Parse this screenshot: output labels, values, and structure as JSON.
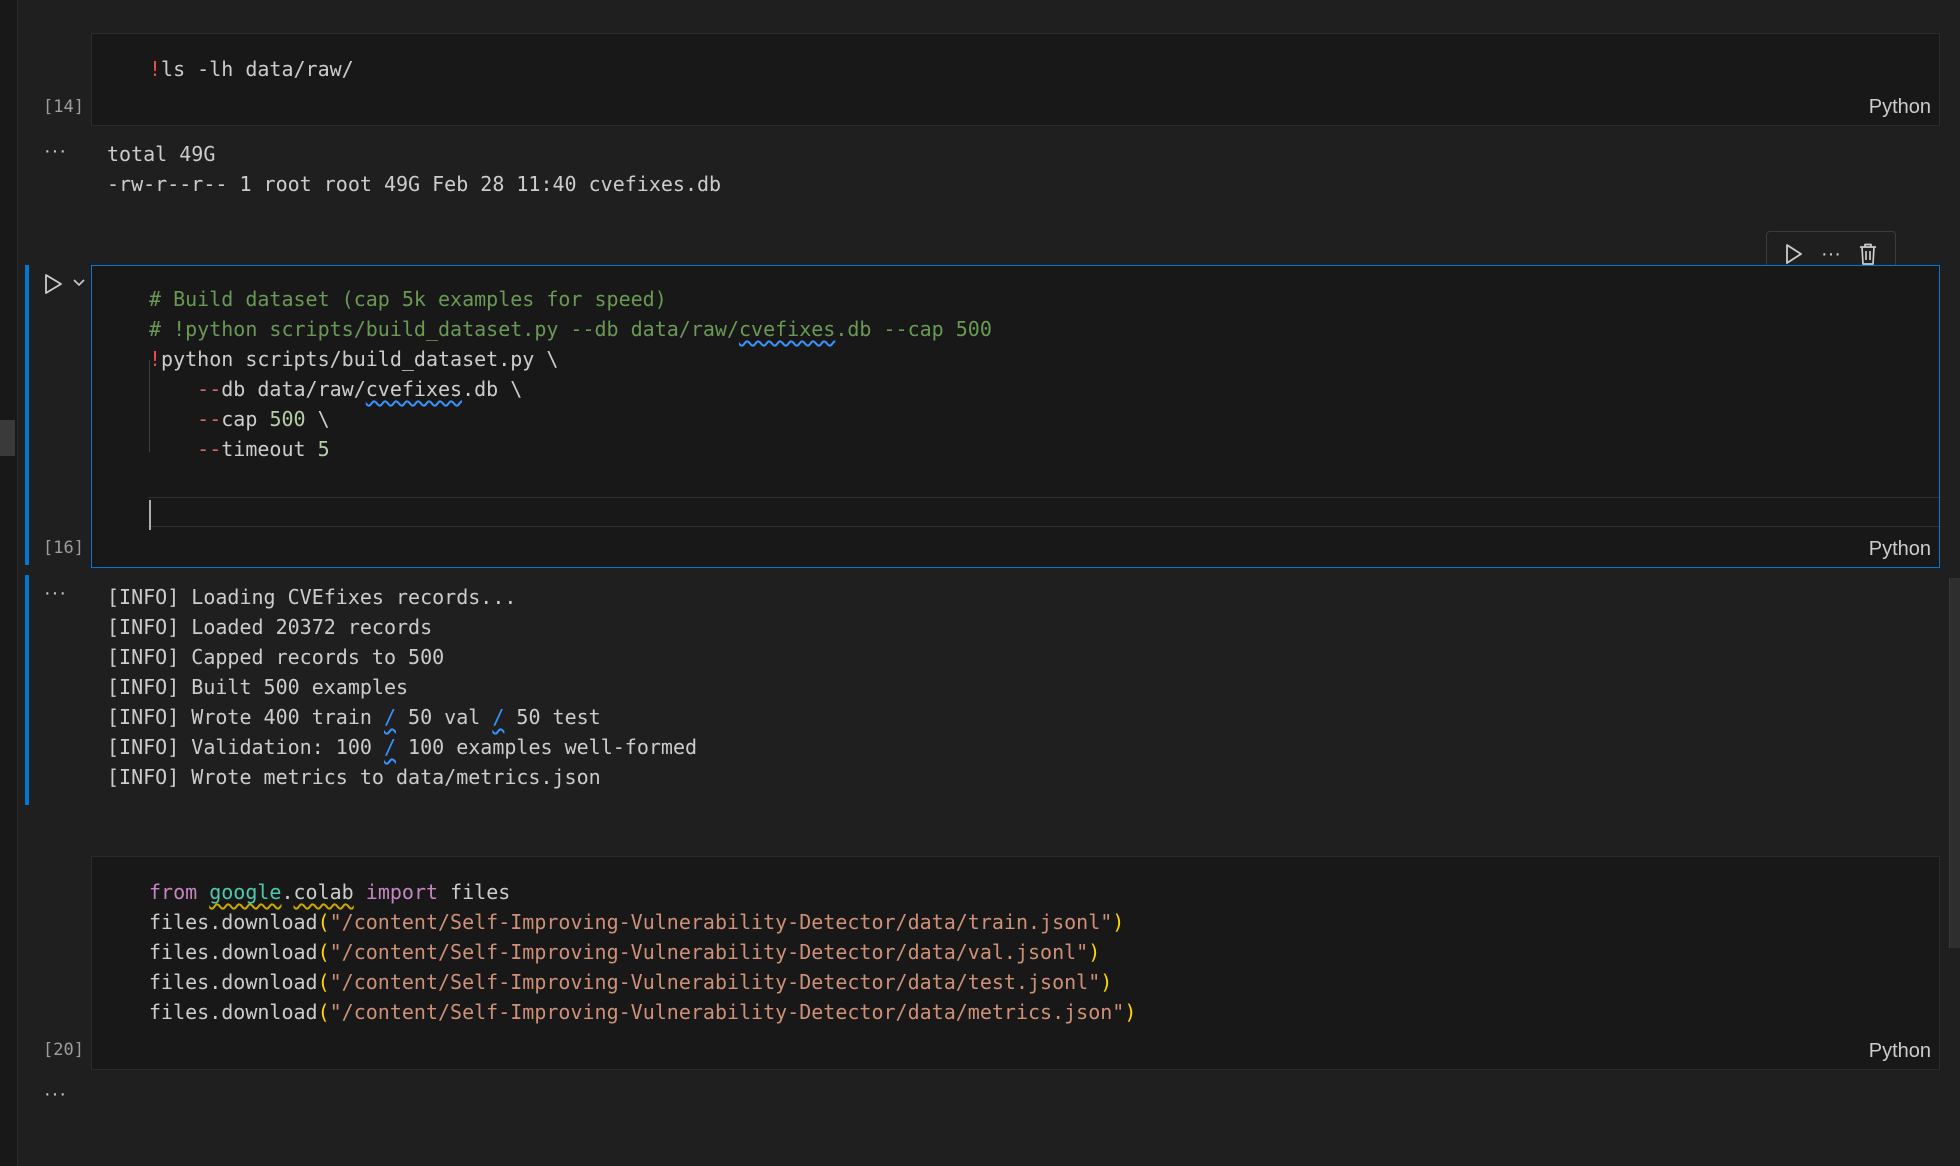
{
  "cells": [
    {
      "exec_count": "[14]",
      "lang": "Python",
      "code": {
        "bang": "!",
        "cmd": "ls -lh data/raw/"
      },
      "output": [
        "total 49G",
        "-rw-r--r-- 1 root root 49G Feb 28 11:40 cvefixes.db"
      ],
      "output_more": "···"
    },
    {
      "exec_count": "[16]",
      "lang": "Python",
      "code": {
        "comment1": "# Build dataset (cap 5k examples for speed)",
        "comment2a": "# !python scripts/build_dataset.py --db data/raw/",
        "comment2b": "cvefixes",
        "comment2c": ".db --cap 500",
        "bang": "!",
        "line3": "python scripts/build_dataset.py \\",
        "flag_dash": "--",
        "db": "db data/raw/",
        "db_sq": "cvefixes",
        "db_tail": ".db \\",
        "cap": "cap ",
        "cap_val": "500",
        "cap_tail": " \\",
        "timeout": "timeout ",
        "timeout_val": "5"
      },
      "output": {
        "l1": "[INFO] Loading CVEfixes records...",
        "l2": "[INFO] Loaded 20372 records",
        "l3": "[INFO] Capped records to 500",
        "l4": "[INFO] Built 500 examples",
        "l5a": "[INFO] Wrote 400 train ",
        "l5b": " 50 val ",
        "l5c": " 50 test",
        "l6a": "[INFO] Validation: 100 ",
        "l6b": " 100 examples well-formed",
        "l7": "[INFO] Wrote metrics to data/metrics.json",
        "slash": "/"
      },
      "output_more": "···",
      "toolbar": {
        "more_label": "···"
      }
    },
    {
      "exec_count": "[20]",
      "lang": "Python",
      "code": {
        "from": "from",
        "mod1": "google",
        "dot": ".",
        "mod2": "colab",
        "import": "import",
        "files": " files",
        "call": "files.download",
        "open": "(",
        "close": ")",
        "s1": "\"/content/Self-Improving-Vulnerability-Detector/data/train.jsonl\"",
        "s2": "\"/content/Self-Improving-Vulnerability-Detector/data/val.jsonl\"",
        "s3": "\"/content/Self-Improving-Vulnerability-Detector/data/test.jsonl\"",
        "s4": "\"/content/Self-Improving-Vulnerability-Detector/data/metrics.json\""
      },
      "output_more": "···"
    }
  ],
  "colors": {
    "accent": "#0078d4",
    "background": "#1f1f1f",
    "cell_background": "#181818",
    "comment": "#6a9955",
    "string": "#ce9178",
    "keyword": "#c586c0",
    "error_red": "#f14c4c"
  },
  "icons": {
    "run": "run-icon",
    "chevron": "chevron-down-icon",
    "more": "ellipsis-icon",
    "delete": "trash-icon"
  }
}
